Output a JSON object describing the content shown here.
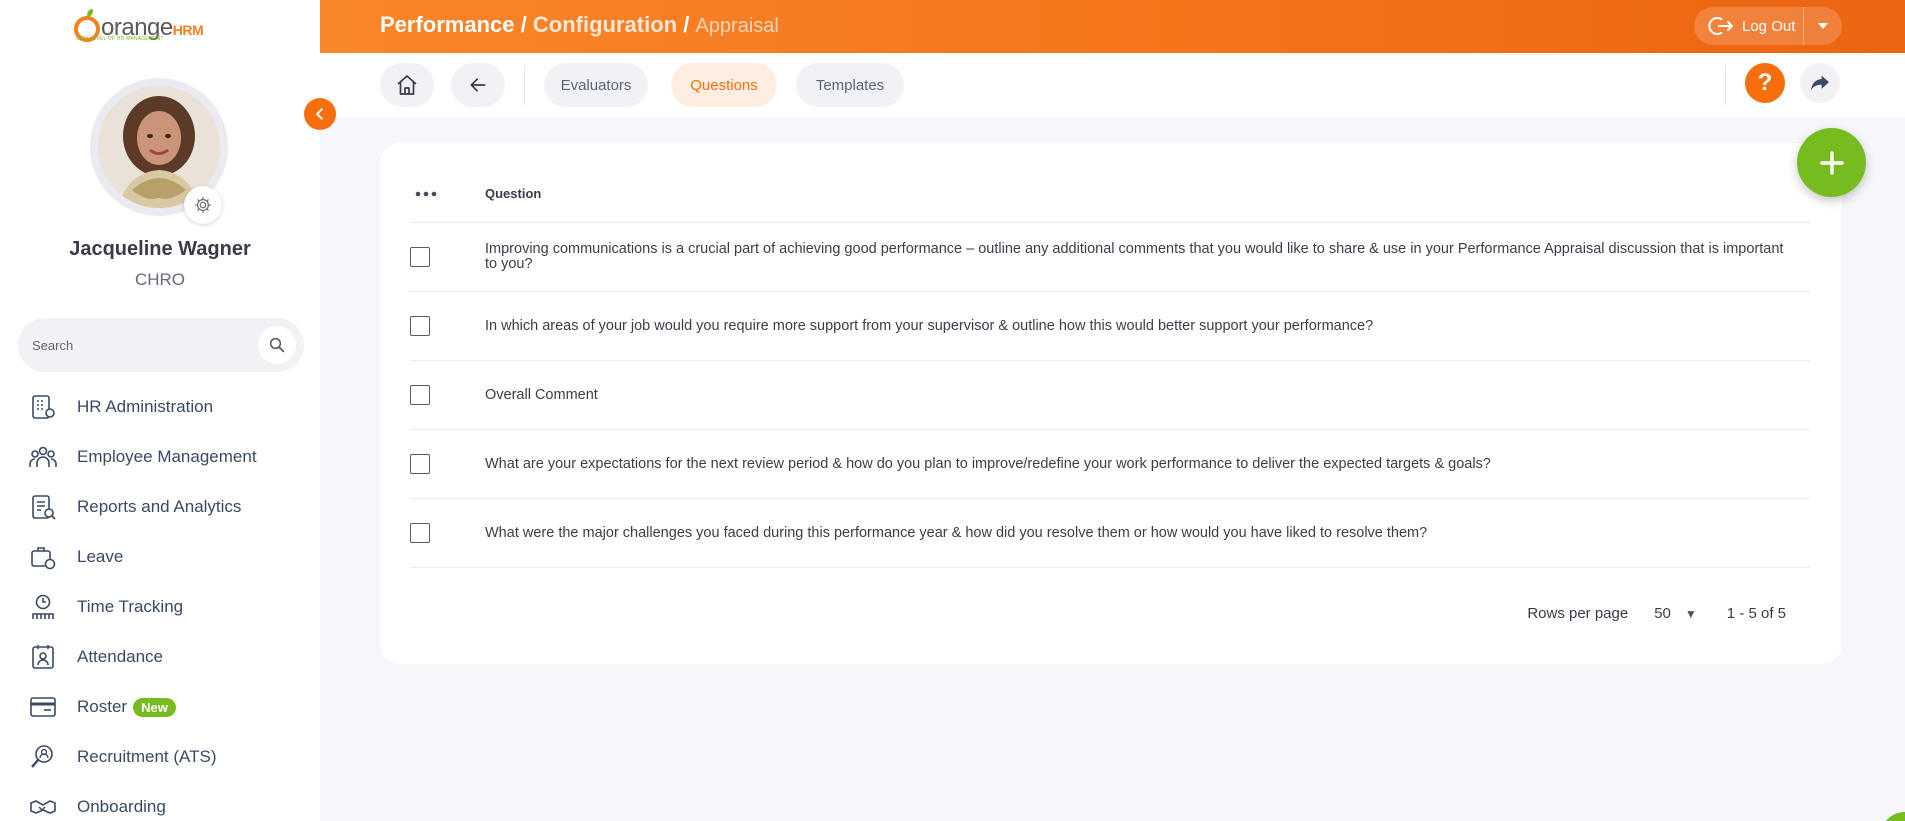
{
  "app": {
    "logo_text": "orange",
    "logo_hrm": "HRM",
    "logo_tagline": "NEW LEVEL OF HR MANAGEMENT"
  },
  "user": {
    "name": "Jacqueline Wagner",
    "role": "CHRO"
  },
  "search": {
    "placeholder": "Search"
  },
  "sidebar": {
    "items": [
      {
        "label": "HR Administration",
        "icon": "hr-admin-icon"
      },
      {
        "label": "Employee Management",
        "icon": "employees-icon"
      },
      {
        "label": "Reports and Analytics",
        "icon": "reports-icon"
      },
      {
        "label": "Leave",
        "icon": "leave-icon"
      },
      {
        "label": "Time Tracking",
        "icon": "time-tracking-icon"
      },
      {
        "label": "Attendance",
        "icon": "attendance-icon"
      },
      {
        "label": "Roster",
        "icon": "roster-icon",
        "badge": "New"
      },
      {
        "label": "Recruitment (ATS)",
        "icon": "recruitment-icon"
      },
      {
        "label": "Onboarding",
        "icon": "onboarding-icon"
      }
    ]
  },
  "breadcrumb": {
    "module": "Performance",
    "separator": "/",
    "section": "Configuration",
    "page": "Appraisal"
  },
  "header": {
    "logout_label": "Log Out"
  },
  "tabs": {
    "evaluators": "Evaluators",
    "questions": "Questions",
    "templates": "Templates",
    "active": "Questions"
  },
  "table": {
    "column_question": "Question",
    "rows": [
      "Improving communications is a crucial part of achieving good performance – outline any additional comments that you would like to share & use in your Performance Appraisal discussion that is important to you?",
      "In which areas of your job would you require more support from your supervisor & outline how this would better support your performance?",
      "Overall Comment",
      "What are your expectations for the next review period & how do you plan to improve/redefine your work performance to deliver the expected targets & goals?",
      "What were the major challenges you faced during this performance year & how did you resolve them or how would you have liked to resolve them?"
    ]
  },
  "pagination": {
    "rows_per_page_label": "Rows per page",
    "rows_per_page_value": "50",
    "range": "1 - 5 of 5"
  },
  "colors": {
    "brand_orange": "#f76f0c",
    "brand_green": "#76bc21",
    "active_tab_bg": "#fdeee1"
  }
}
